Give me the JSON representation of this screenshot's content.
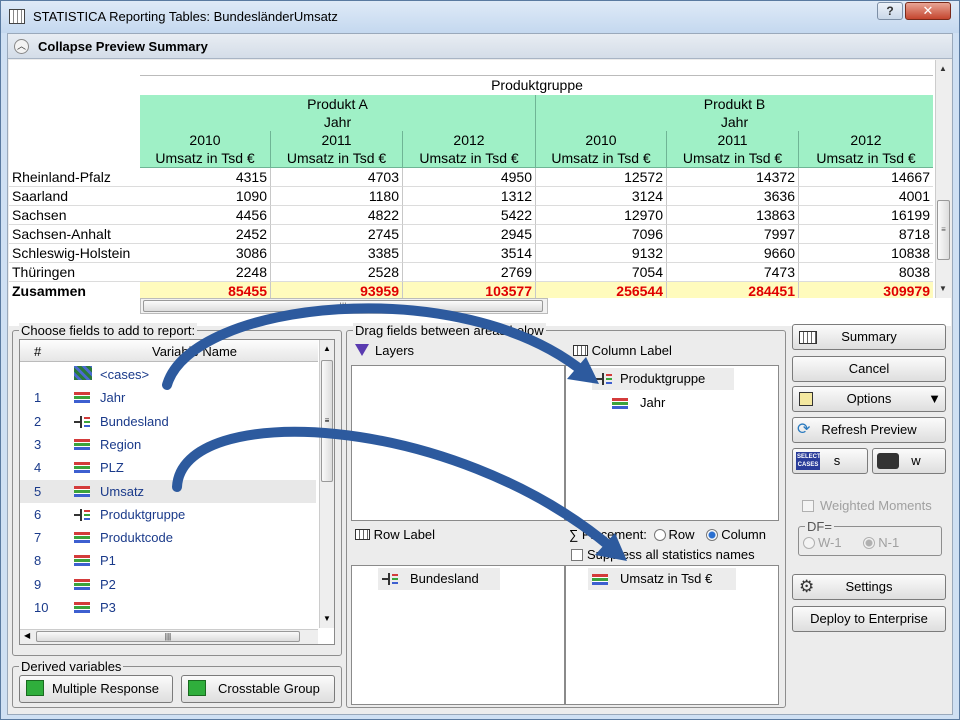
{
  "window": {
    "title": "STATISTICA Reporting Tables: BundesländerUmsatz",
    "help": "?",
    "close": "✕"
  },
  "collapse": {
    "label": "Collapse Preview Summary"
  },
  "preview": {
    "top_header": "Produktgruppe",
    "groups": [
      "Produkt A",
      "Produkt B"
    ],
    "jahr_label": "Jahr",
    "years": [
      "2010",
      "2011",
      "2012",
      "2010",
      "2011",
      "2012"
    ],
    "measure": "Umsatz in Tsd €",
    "rows": [
      {
        "label": "Rheinland-Pfalz",
        "values": [
          "4315",
          "4703",
          "4950",
          "12572",
          "14372",
          "14667"
        ]
      },
      {
        "label": "Saarland",
        "values": [
          "1090",
          "1180",
          "1312",
          "3124",
          "3636",
          "4001"
        ]
      },
      {
        "label": "Sachsen",
        "values": [
          "4456",
          "4822",
          "5422",
          "12970",
          "13863",
          "16199"
        ]
      },
      {
        "label": "Sachsen-Anhalt",
        "values": [
          "2452",
          "2745",
          "2945",
          "7096",
          "7997",
          "8718"
        ]
      },
      {
        "label": "Schleswig-Holstein",
        "values": [
          "3086",
          "3385",
          "3514",
          "9132",
          "9660",
          "10838"
        ]
      },
      {
        "label": "Thüringen",
        "values": [
          "2248",
          "2528",
          "2769",
          "7054",
          "7473",
          "8038"
        ]
      }
    ],
    "total": {
      "label": "Zusammen",
      "values": [
        "85455",
        "93959",
        "103577",
        "256544",
        "284451",
        "309979"
      ]
    }
  },
  "fields": {
    "legend": "Choose fields to add to report:",
    "col_num": "#",
    "col_name": "Variable Name",
    "items": [
      {
        "num": "",
        "name": "<cases>",
        "icon": "cases-icon"
      },
      {
        "num": "1",
        "name": "Jahr",
        "icon": "bars-icon"
      },
      {
        "num": "2",
        "name": "Bundesland",
        "icon": "tree-icon"
      },
      {
        "num": "3",
        "name": "Region",
        "icon": "bars-icon"
      },
      {
        "num": "4",
        "name": "PLZ",
        "icon": "bars-icon"
      },
      {
        "num": "5",
        "name": "Umsatz",
        "icon": "bars-icon",
        "selected": true
      },
      {
        "num": "6",
        "name": "Produktgruppe",
        "icon": "tree-icon"
      },
      {
        "num": "7",
        "name": "Produktcode",
        "icon": "bars-icon"
      },
      {
        "num": "8",
        "name": "P1",
        "icon": "bars-icon"
      },
      {
        "num": "9",
        "name": "P2",
        "icon": "bars-icon"
      },
      {
        "num": "10",
        "name": "P3",
        "icon": "bars-icon"
      }
    ]
  },
  "drag": {
    "legend": "Drag fields between areas below",
    "layers": "Layers",
    "column_label": "Column Label",
    "column_items": [
      "Produktgruppe",
      "Jahr"
    ],
    "row_label": "Row Label",
    "row_items": [
      "Bundesland"
    ],
    "placement_label": "∑ Placement:",
    "placement_row": "Row",
    "placement_column": "Column",
    "suppress": "Suppress all statistics names",
    "stat_items": [
      "Umsatz in Tsd €"
    ]
  },
  "derived": {
    "legend": "Derived variables",
    "multiple_response": "Multiple Response",
    "crosstable_group": "Crosstable Group"
  },
  "side": {
    "summary": "Summary",
    "cancel": "Cancel",
    "options": "Options",
    "refresh": "Refresh Preview",
    "select_cases_icon": "SELECT CASES",
    "select_cases_btn": "s",
    "weight_btn": "w",
    "weighted_moments": "Weighted Moments",
    "df_label": "DF=",
    "df_w1": "W-1",
    "df_n1": "N-1",
    "settings": "Settings",
    "deploy": "Deploy to Enterprise"
  },
  "colors": {
    "header_green": "#9ff0c6",
    "total_yellow": "#fffbbd",
    "total_red": "#e00000",
    "arrow_blue": "#2d5a9e"
  }
}
